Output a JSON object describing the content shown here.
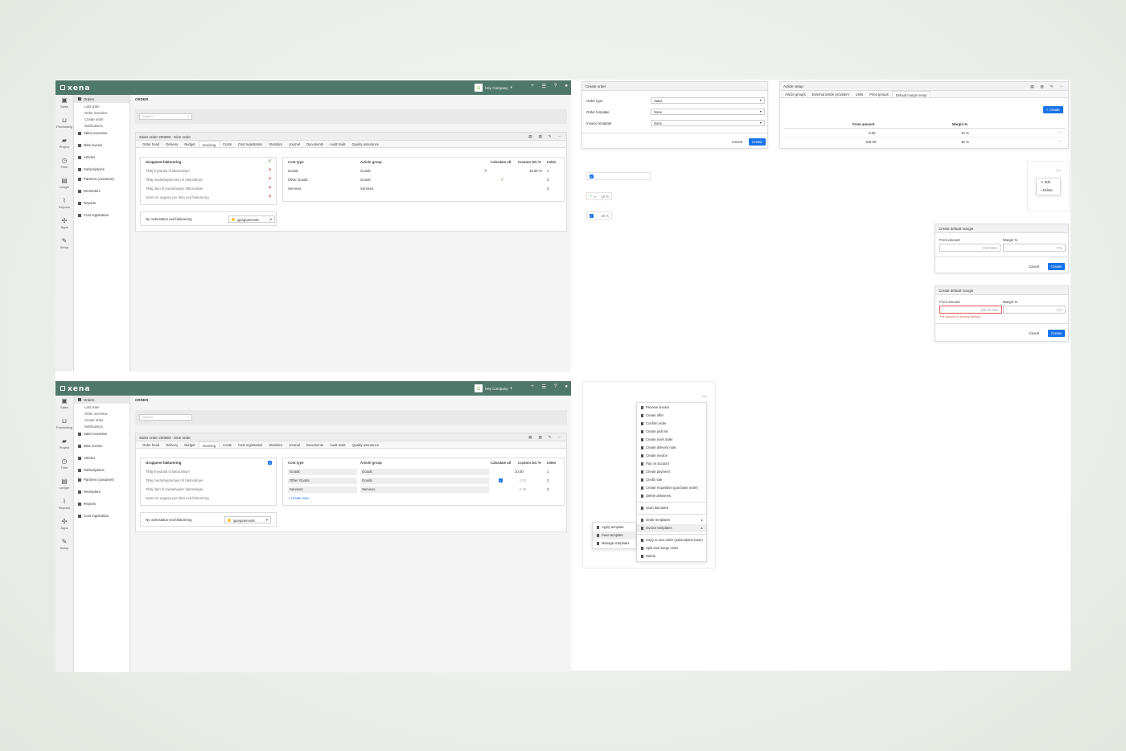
{
  "app": {
    "logo": "xena",
    "company": "Hey Company",
    "topicons": [
      "+",
      "rss-icon",
      "?",
      "user-icon"
    ]
  },
  "iconbar": [
    "Sales",
    "Purchasing",
    "Project",
    "Time",
    "Ledger",
    "Reports",
    "Apps",
    "Setup"
  ],
  "sidebar": {
    "items": [
      "Orders",
      "Sales overview",
      "Miss invoice",
      "Articles",
      "Subscriptions",
      "Partners (customer)",
      "Reminders",
      "Reports",
      "Cost registration"
    ],
    "subitems": [
      "Last order",
      "Order overview",
      "Create order",
      "Notifications"
    ]
  },
  "order": {
    "page_title": "ORDER",
    "search_placeholder": "Search",
    "card_title": "Sales order 200693 - Nice order",
    "tabs": [
      "Order head",
      "Delivery",
      "Budget",
      "Invoicing",
      "Costs",
      "Cost registration",
      "Statistics",
      "Journal",
      "Documents",
      "Audit trails",
      "Quality assurance"
    ],
    "active_tab": "Invoicing",
    "left_rows": [
      "Grupperet fakturering",
      "Tilføj linjeantal til fakturalinjer",
      "Tilføj medarbejdernavn til fakturalinjer",
      "Tilføj dato til medarbejder fakturalinjer",
      "Opret en opgave per dato ved fakturering"
    ],
    "status_label": "Ny ordrestatus ved fakturering",
    "status_value": "igangværende",
    "cols": [
      "Cost type",
      "Article group",
      "Calculate all",
      "Custom DG %",
      "Index"
    ],
    "rows": [
      {
        "cost": "Goods",
        "group": "Goods",
        "dg": "10.00 %",
        "index": "1"
      },
      {
        "cost": "Other Goods",
        "group": "Goods",
        "dg": "",
        "index": "2"
      },
      {
        "cost": "Services",
        "group": "Services",
        "dg": "",
        "index": "3"
      }
    ],
    "rows2": [
      {
        "cost": "Goods",
        "group": "Goods",
        "dg": "10.00",
        "index": "1"
      },
      {
        "cost": "Other Goods",
        "group": "Goods",
        "dg": "0.00",
        "index": "2"
      },
      {
        "cost": "Services",
        "group": "Services",
        "dg": "0.00",
        "index": "3"
      }
    ],
    "create_new": "+ Create new"
  },
  "create_order": {
    "title": "Create order",
    "fields": [
      {
        "label": "Order type",
        "value": "Sales"
      },
      {
        "label": "Order template",
        "value": "None"
      },
      {
        "label": "Invoice template",
        "value": "None"
      }
    ],
    "cancel": "Cancel",
    "create": "Create"
  },
  "article_setup": {
    "title": "Article setup",
    "tabs": [
      "Article groups",
      "External article providers",
      "Units",
      "Price groups",
      "Default margin setup"
    ],
    "create": "+ Create",
    "cols": [
      "From amount",
      "Margin %"
    ],
    "rows": [
      {
        "from": "0.00",
        "margin": "10 %"
      },
      {
        "from": "100.00",
        "margin": "40 %"
      }
    ]
  },
  "misc": {
    "pct1": "25 %",
    "pct2": "25 %",
    "edit": "Edit",
    "delete": "Delete"
  },
  "margin1": {
    "title": "Create default margin",
    "from_label": "From amount",
    "margin_label": "Margin %",
    "from_val": "0.00  DKK",
    "margin_val": "0  %",
    "cancel": "Cancel",
    "create": "Create"
  },
  "margin2": {
    "title": "Create default margin",
    "from_label": "From amount",
    "margin_label": "Margin %",
    "from_val": "100.00  DKK",
    "margin_val": "0  %",
    "error": "The amount is already defined",
    "cancel": "Cancel",
    "create": "Create"
  },
  "context_menu": [
    "Preview invoice",
    "Create offer",
    "Confirm order",
    "Create pick list",
    "Create work order",
    "Create delivery note",
    "Create invoice",
    "Pay on account",
    "Create payment",
    "Credit note",
    "Create requisition (purchase order)",
    "Delete deliveries",
    "Scan barcodes",
    "Order templates",
    "Invoice templates",
    "Copy to new order (subscription base)",
    "Split and merge order",
    "Delete"
  ],
  "template_menu": [
    "Apply template",
    "Save template",
    "Manage templates"
  ]
}
